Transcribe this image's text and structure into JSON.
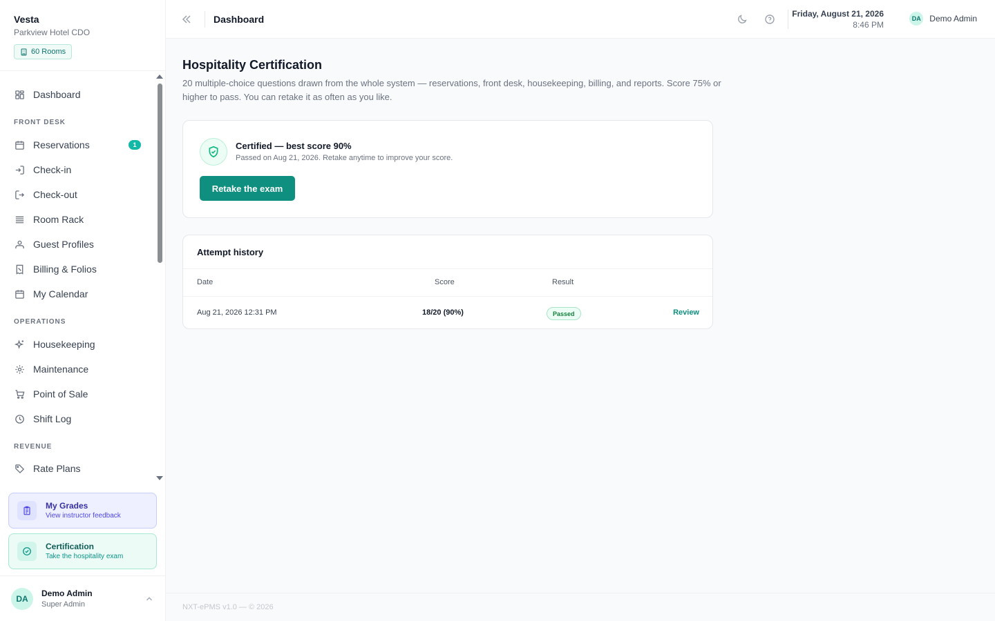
{
  "brand": {
    "name": "Vesta",
    "property": "Parkview Hotel CDO",
    "rooms_badge": "60 Rooms"
  },
  "sidebar": {
    "items": [
      {
        "label": "Dashboard",
        "icon": "grid-icon"
      },
      {
        "label": "Reservations",
        "icon": "calendar-icon",
        "badge": "1"
      },
      {
        "label": "Check-in",
        "icon": "login-icon"
      },
      {
        "label": "Check-out",
        "icon": "logout-icon"
      },
      {
        "label": "Room Rack",
        "icon": "list-icon"
      },
      {
        "label": "Guest Profiles",
        "icon": "users-icon"
      },
      {
        "label": "Billing & Folios",
        "icon": "receipt-icon"
      },
      {
        "label": "My Calendar",
        "icon": "calendar-icon"
      },
      {
        "label": "Housekeeping",
        "icon": "sparkle-icon"
      },
      {
        "label": "Maintenance",
        "icon": "gear-icon"
      },
      {
        "label": "Point of Sale",
        "icon": "cart-icon"
      },
      {
        "label": "Shift Log",
        "icon": "clock-icon"
      },
      {
        "label": "Rate Plans",
        "icon": "tag-icon"
      }
    ],
    "sections": {
      "front_desk": "FRONT DESK",
      "operations": "OPERATIONS",
      "revenue": "REVENUE"
    },
    "promos": {
      "grades": {
        "title": "My Grades",
        "subtitle": "View instructor feedback"
      },
      "certification": {
        "title": "Certification",
        "subtitle": "Take the hospitality exam"
      }
    },
    "user": {
      "initials": "DA",
      "name": "Demo Admin",
      "role": "Super Admin"
    }
  },
  "header": {
    "title": "Dashboard",
    "date": "Friday, August 21, 2026",
    "time": "8:46 PM",
    "user_initials": "DA",
    "user_name": "Demo Admin"
  },
  "main": {
    "title": "Hospitality Certification",
    "description": "20 multiple-choice questions drawn from the whole system — reservations, front desk, housekeeping, billing, and reports. Score 75% or higher to pass. You can retake it as often as you like.",
    "status": {
      "title": "Certified — best score 90%",
      "subtitle": "Passed on Aug 21, 2026. Retake anytime to improve your score.",
      "retake_label": "Retake the exam"
    },
    "history": {
      "title": "Attempt history",
      "columns": [
        "Date",
        "Score",
        "Result"
      ],
      "rows": [
        {
          "date": "Aug 21, 2026 12:31 PM",
          "score": "18/20 (90%)",
          "result": "Passed",
          "action": "Review"
        }
      ]
    }
  },
  "footer": {
    "text": "NXT-ePMS v1.0 — © 2026"
  },
  "colors": {
    "accent": "#0f8f80",
    "accent_light": "#ccf5ea",
    "success": "#10b981",
    "indigo": "#4f46e5"
  }
}
